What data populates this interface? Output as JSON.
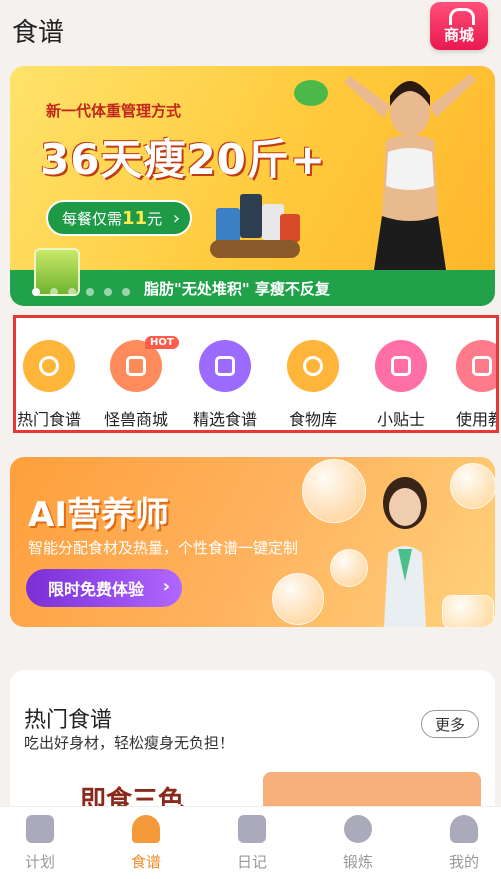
{
  "header": {
    "title": "食谱",
    "shop_label": "商城"
  },
  "banner": {
    "slogan_small": "新一代体重管理方式",
    "slogan_big": "36天瘦20斤+",
    "price_prefix": "每餐仅需",
    "price_value": "11",
    "price_unit": "元",
    "bottom_text": "脂肪\"无处堆积\" 享瘦不反复",
    "active_slide": 1,
    "slides": 6
  },
  "quick_menu": [
    {
      "label": "热门食谱",
      "icon": "hot-recipe-icon",
      "color": "#ffb53a"
    },
    {
      "label": "怪兽商城",
      "icon": "shop-icon",
      "color": "#ff8a5b",
      "badge": "HOT"
    },
    {
      "label": "精选食谱",
      "icon": "star-recipe-icon",
      "color": "#9b6bff"
    },
    {
      "label": "食物库",
      "icon": "food-library-icon",
      "color": "#ffb53a"
    },
    {
      "label": "小贴士",
      "icon": "tips-icon",
      "color": "#ff6fa5"
    },
    {
      "label": "使用教",
      "icon": "tutorial-icon",
      "color": "#ff7a8a"
    }
  ],
  "ai_card": {
    "title": "AI营养师",
    "subtitle": "智能分配食材及热量，个性食谱一键定制",
    "button": "限时免费体验"
  },
  "hot_section": {
    "title": "热门食谱",
    "subtitle": "吃出好身材，轻松瘦身无负担！",
    "more": "更多",
    "peek_text": "即食三色"
  },
  "tabs": [
    {
      "label": "计划",
      "icon": "plan-icon",
      "active": false
    },
    {
      "label": "食谱",
      "icon": "chef-hat-icon",
      "active": true
    },
    {
      "label": "日记",
      "icon": "diary-icon",
      "active": false
    },
    {
      "label": "锻炼",
      "icon": "dumbbell-icon",
      "active": false
    },
    {
      "label": "我的",
      "icon": "profile-icon",
      "active": false
    }
  ],
  "colors": {
    "accent": "#f28c28",
    "banner_green": "#21a24a",
    "highlight_border": "#e53935"
  }
}
